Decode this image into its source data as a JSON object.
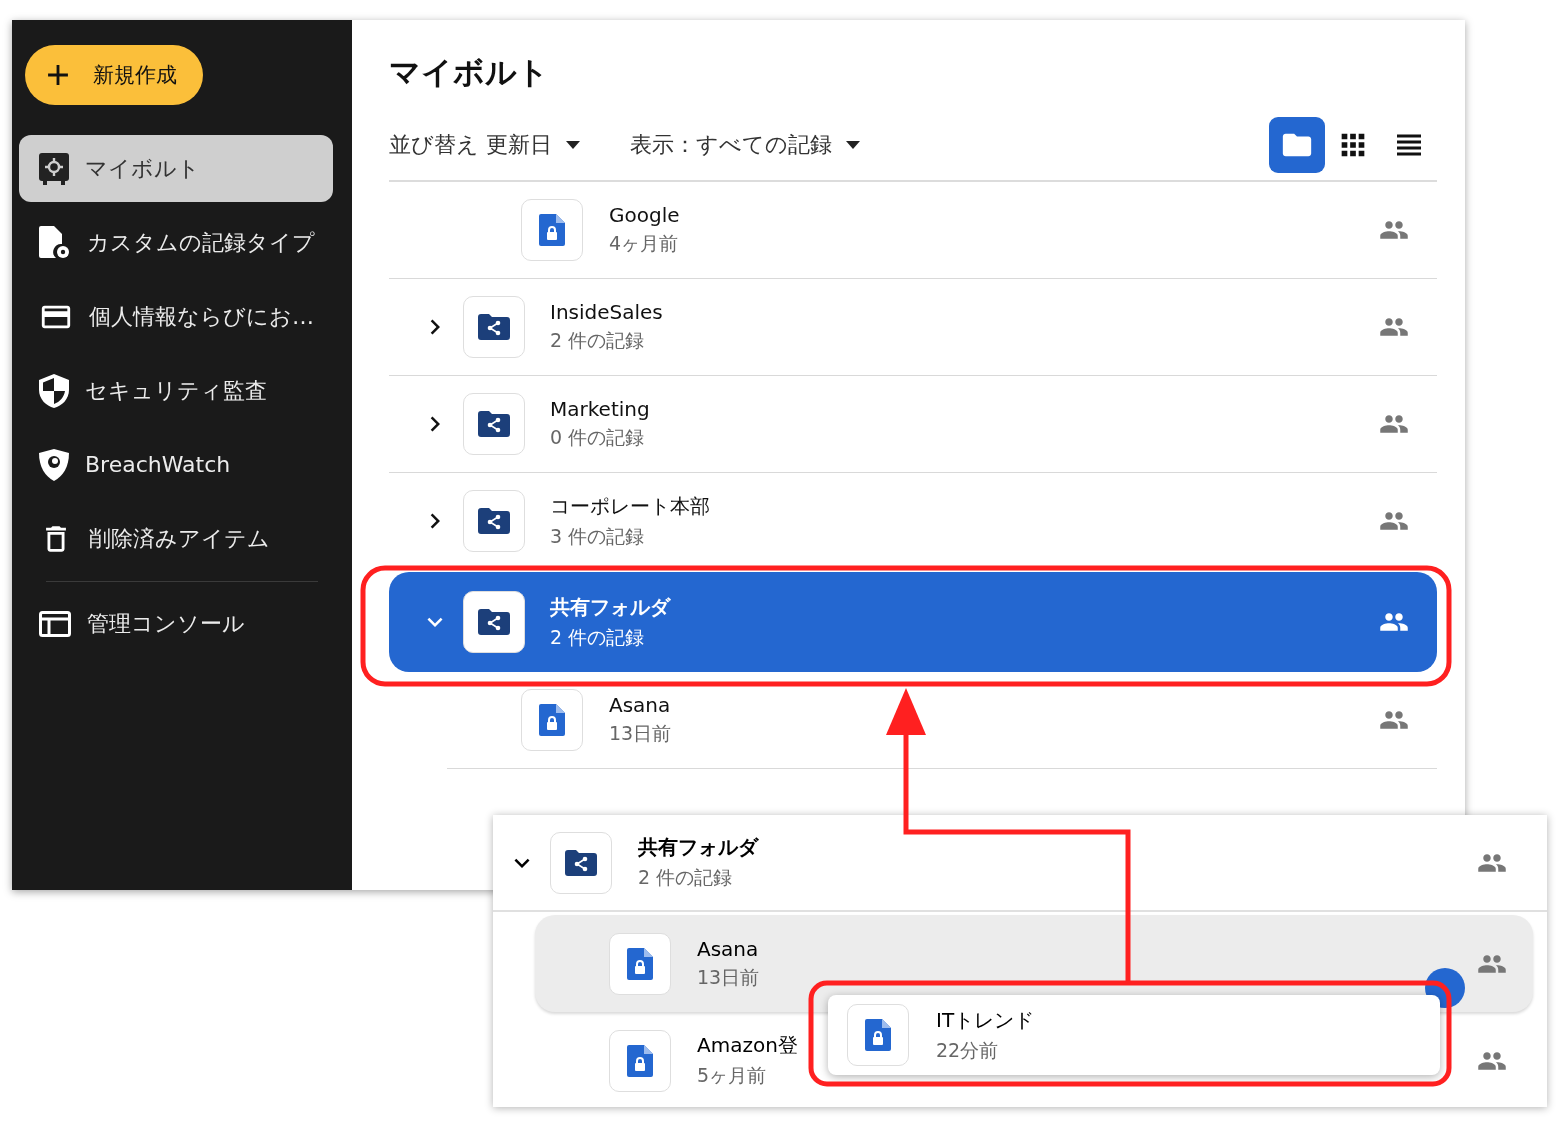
{
  "sidebar": {
    "new_button": "新規作成",
    "items": [
      {
        "kind": "vault",
        "label": "マイボルト",
        "selected": true
      },
      {
        "kind": "record-types",
        "label": "カスタムの記録タイプ",
        "selected": false
      },
      {
        "kind": "card",
        "label": "個人情報ならびにお…",
        "selected": false
      },
      {
        "kind": "audit",
        "label": "セキュリティ監査",
        "selected": false
      },
      {
        "kind": "breachwatch",
        "label": "BreachWatch",
        "selected": false
      },
      {
        "kind": "trash",
        "label": "削除済みアイテム",
        "selected": false
      }
    ],
    "footer_items": [
      {
        "kind": "console",
        "label": "管理コンソール",
        "selected": false
      }
    ]
  },
  "main": {
    "title": "マイボルト",
    "sort": "並び替え 更新日",
    "filter": "表示：すべての記録",
    "view_modes": [
      {
        "kind": "folder",
        "selected": true
      },
      {
        "kind": "grid",
        "selected": false
      },
      {
        "kind": "list",
        "selected": false
      }
    ],
    "rows": [
      {
        "kind": "record",
        "title": "Google",
        "subtitle": "4ヶ月前",
        "selected": false
      },
      {
        "kind": "folder",
        "title": "InsideSales",
        "subtitle": "2 件の記録",
        "expanded": false,
        "selected": false
      },
      {
        "kind": "folder",
        "title": "Marketing",
        "subtitle": "0 件の記録",
        "expanded": false,
        "selected": false
      },
      {
        "kind": "folder",
        "title": "コーポレート本部",
        "subtitle": "3 件の記録",
        "expanded": false,
        "selected": false
      },
      {
        "kind": "folder",
        "title": "共有フォルダ",
        "subtitle": "2 件の記録",
        "expanded": true,
        "selected": true,
        "children": [
          {
            "kind": "record",
            "title": "Asana",
            "subtitle": "13日前",
            "selected": false
          }
        ]
      }
    ]
  },
  "drag_preview": {
    "folder": {
      "title": "共有フォルダ",
      "subtitle": "2 件の記録",
      "expanded": true
    },
    "children": [
      {
        "title": "Asana",
        "subtitle": "13日前",
        "highlighted": true
      },
      {
        "title": "Amazon登",
        "subtitle": "5ヶ月前",
        "highlighted": false
      }
    ],
    "dragged": {
      "title": "ITトレンド",
      "subtitle": "22分前"
    }
  }
}
